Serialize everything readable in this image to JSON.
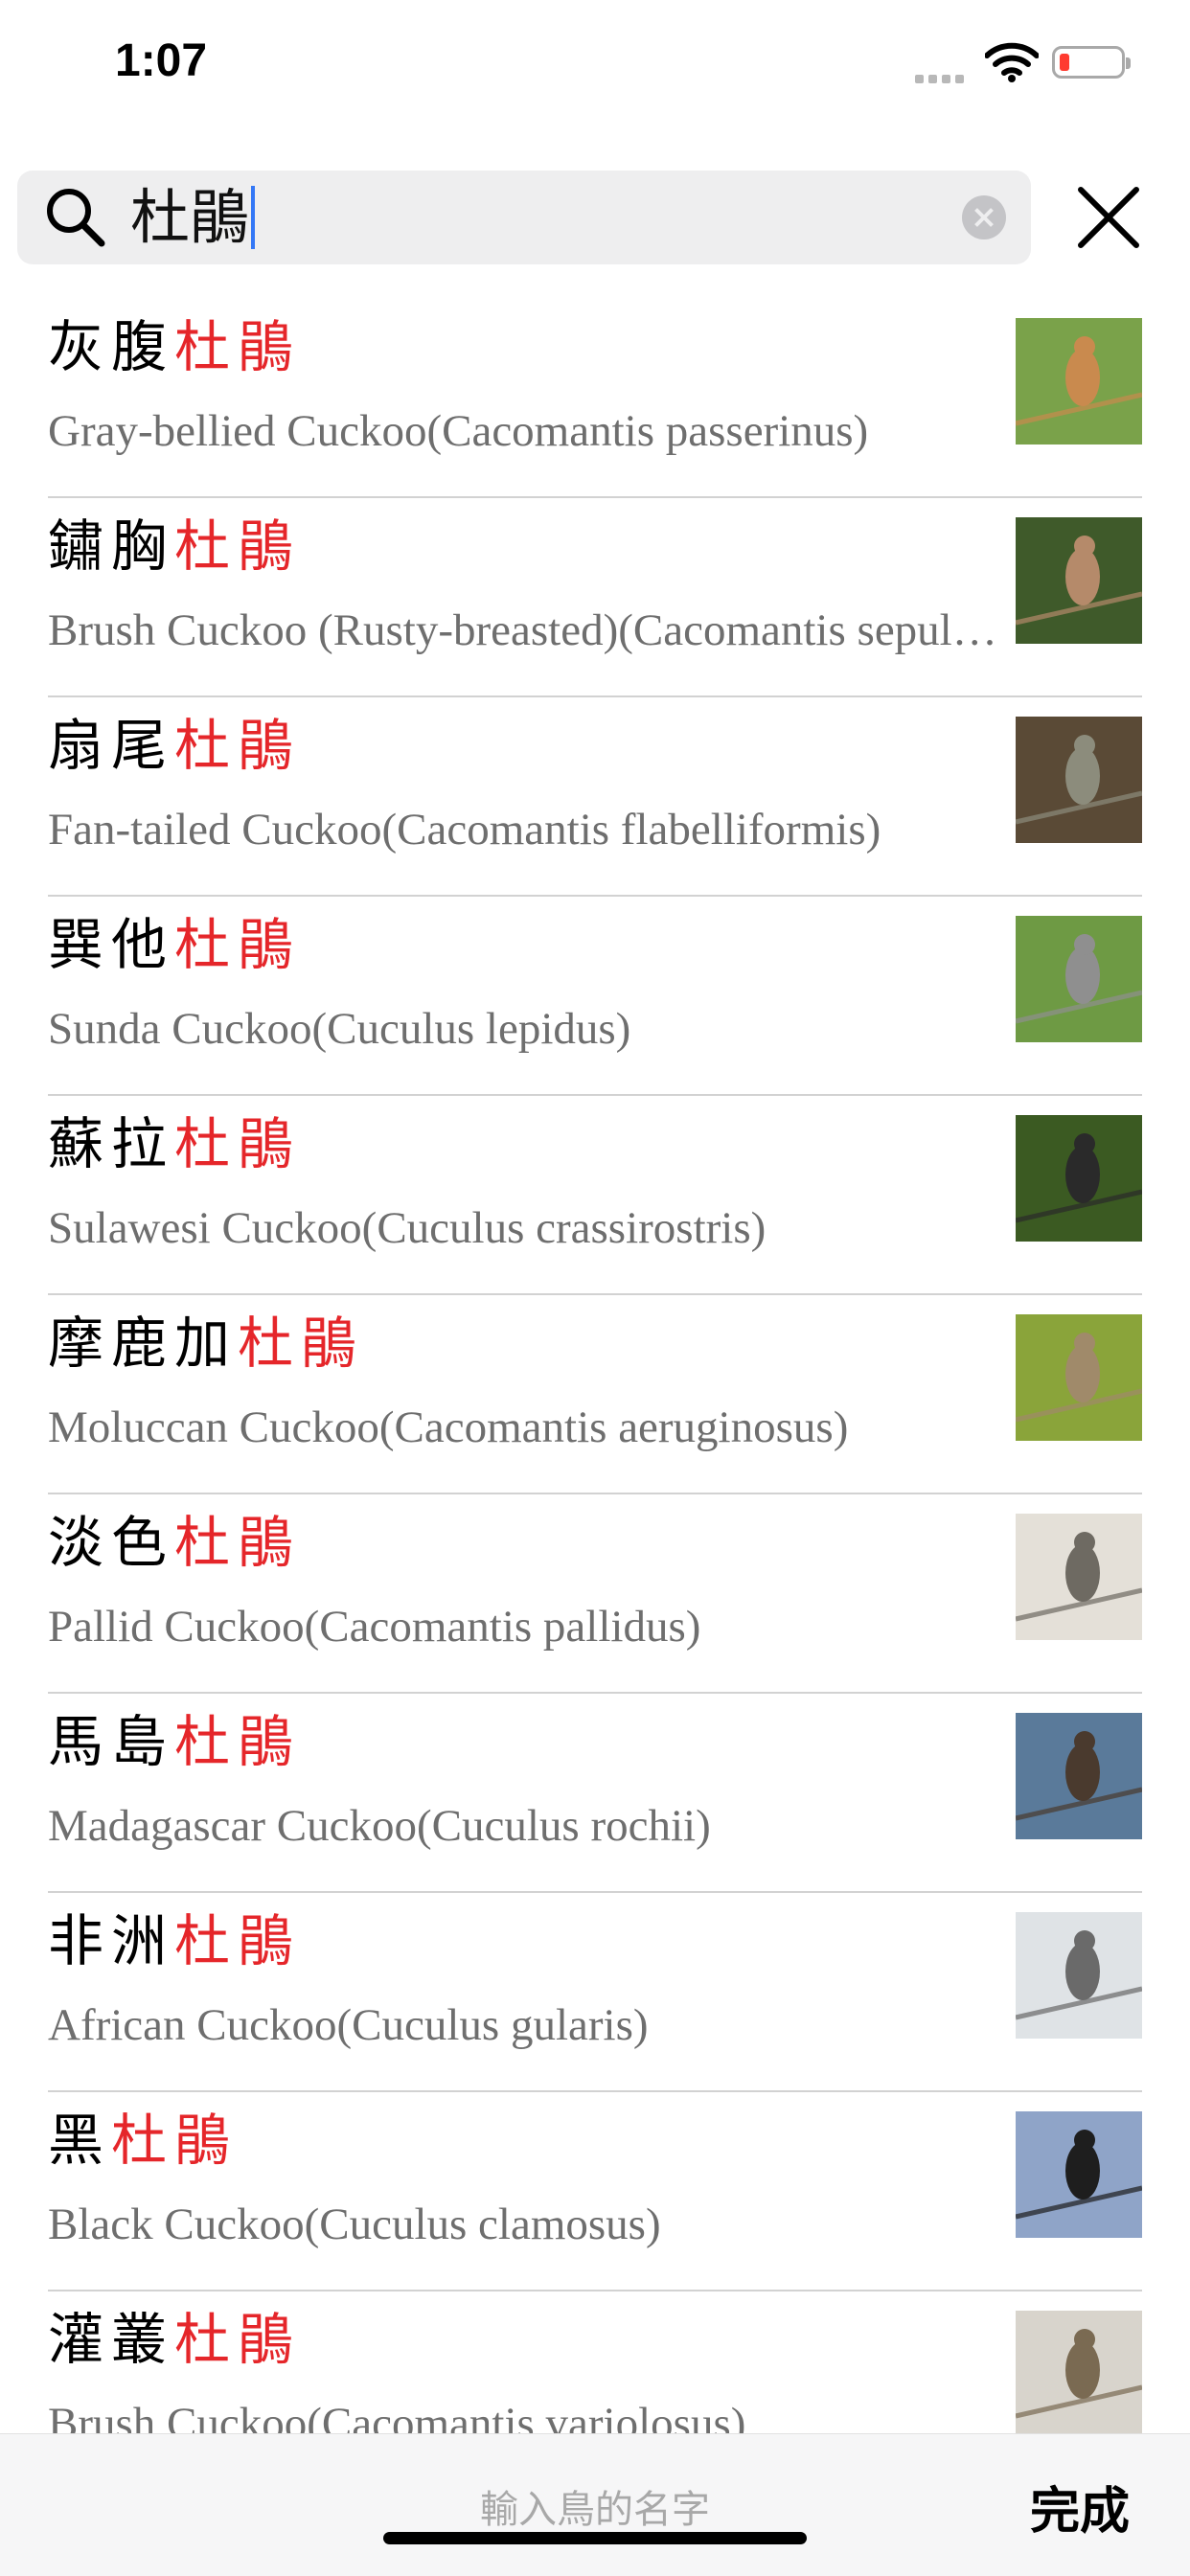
{
  "status_bar": {
    "time": "1:07",
    "battery_level": 0.1,
    "battery_color": "#ff3b30"
  },
  "search": {
    "query": "杜鵑",
    "icon": "search-icon",
    "clear_icon": "clear-icon",
    "close_icon": "close-icon"
  },
  "highlight_color": "#e5262a",
  "results": [
    {
      "prefix": "灰腹",
      "match": "杜鵑",
      "english": "Gray-bellied Cuckoo(Cacomantis passerinus)",
      "thumb_colors": [
        "#7aa24a",
        "#c98a4e"
      ]
    },
    {
      "prefix": "鏽胸",
      "match": "杜鵑",
      "english": "Brush Cuckoo (Rusty-breasted)(Cacomantis sepulcralis)",
      "thumb_colors": [
        "#3f5a2a",
        "#b58a6a"
      ]
    },
    {
      "prefix": "扇尾",
      "match": "杜鵑",
      "english": "Fan-tailed Cuckoo(Cacomantis flabelliformis)",
      "thumb_colors": [
        "#5a4a36",
        "#8c8c7c"
      ]
    },
    {
      "prefix": "巽他",
      "match": "杜鵑",
      "english": "Sunda Cuckoo(Cuculus lepidus)",
      "thumb_colors": [
        "#6e9a44",
        "#8f8f8f"
      ]
    },
    {
      "prefix": "蘇拉",
      "match": "杜鵑",
      "english": "Sulawesi Cuckoo(Cuculus crassirostris)",
      "thumb_colors": [
        "#3b5a22",
        "#2a2a2a"
      ]
    },
    {
      "prefix": "摩鹿加",
      "match": "杜鵑",
      "english": "Moluccan Cuckoo(Cacomantis aeruginosus)",
      "thumb_colors": [
        "#8aa43a",
        "#a08a6a"
      ]
    },
    {
      "prefix": "淡色",
      "match": "杜鵑",
      "english": "Pallid Cuckoo(Cacomantis pallidus)",
      "thumb_colors": [
        "#e4e0d8",
        "#6e6a62"
      ]
    },
    {
      "prefix": "馬島",
      "match": "杜鵑",
      "english": "Madagascar Cuckoo(Cuculus rochii)",
      "thumb_colors": [
        "#5a7a9a",
        "#4a3a2e"
      ]
    },
    {
      "prefix": "非洲",
      "match": "杜鵑",
      "english": "African Cuckoo(Cuculus gularis)",
      "thumb_colors": [
        "#dfe3e6",
        "#6a6a6a"
      ]
    },
    {
      "prefix": "黑",
      "match": "杜鵑",
      "english": "Black Cuckoo(Cuculus clamosus)",
      "thumb_colors": [
        "#8fa4c8",
        "#1e1e1e"
      ]
    },
    {
      "prefix": "灌叢",
      "match": "杜鵑",
      "english": "Brush Cuckoo(Cacomantis variolosus)",
      "thumb_colors": [
        "#d8d4cc",
        "#7a6a52"
      ]
    }
  ],
  "bottom_bar": {
    "placeholder": "輸入鳥的名字",
    "done_label": "完成"
  }
}
